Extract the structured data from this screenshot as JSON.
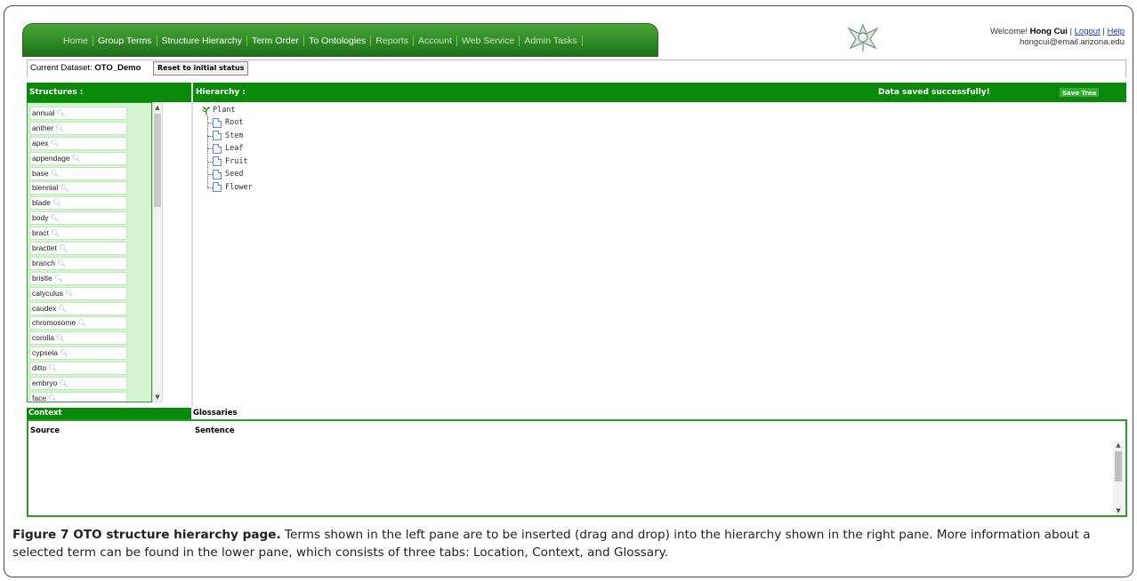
{
  "nav": {
    "items": [
      {
        "label": "Home",
        "style": "dim"
      },
      {
        "label": "Group Terms",
        "style": "bold"
      },
      {
        "label": "Structure Hierarchy",
        "style": "bold"
      },
      {
        "label": "Term Order",
        "style": "bold"
      },
      {
        "label": "To Ontologies",
        "style": "bold"
      },
      {
        "label": "Reports",
        "style": "dim"
      },
      {
        "label": "Account",
        "style": "dim"
      },
      {
        "label": "Web Service",
        "style": "dim"
      },
      {
        "label": "Admin Tasks",
        "style": "dim"
      }
    ]
  },
  "header": {
    "welcome_prefix": "Welcome!",
    "user_name": "Hong Cui",
    "logout": "Logout",
    "help": "Help",
    "separator": "|",
    "email": "hongcui@email.arizona.edu"
  },
  "dataset": {
    "label": "Current Dataset:",
    "name": "OTO_Demo",
    "reset_button": "Reset to initial status"
  },
  "structures": {
    "header": "Structures :",
    "terms": [
      "annual",
      "anther",
      "apex",
      "appendage",
      "base",
      "biennial",
      "blade",
      "body",
      "bract",
      "bractlet",
      "branch",
      "bristle",
      "calyculus",
      "caudex",
      "chromosome",
      "corolla",
      "cypsela",
      "ditto",
      "embryo",
      "face"
    ]
  },
  "hierarchy": {
    "header": "Hierarchy :",
    "status": "Data saved successfully!",
    "save_button": "Save Tree",
    "root": "Plant",
    "children": [
      "Root",
      "Stem",
      "Leaf",
      "Fruit",
      "Seed",
      "Flower"
    ]
  },
  "lower": {
    "tabs": [
      "Context",
      "Glossaries"
    ],
    "columns": [
      "Source",
      "Sentence"
    ]
  },
  "caption": {
    "title": "Figure 7 OTO structure hierarchy page.",
    "text": " Terms shown in the left pane are to be inserted (drag and drop) into the hierarchy shown in the right pane. More information about a selected term can be found in the lower pane, which consists of three tabs: Location, Context, and Glossary."
  },
  "colors": {
    "accent_green": "#0a8a0a",
    "list_bg": "#d4f5d0",
    "link_blue": "#1a3fc0"
  }
}
